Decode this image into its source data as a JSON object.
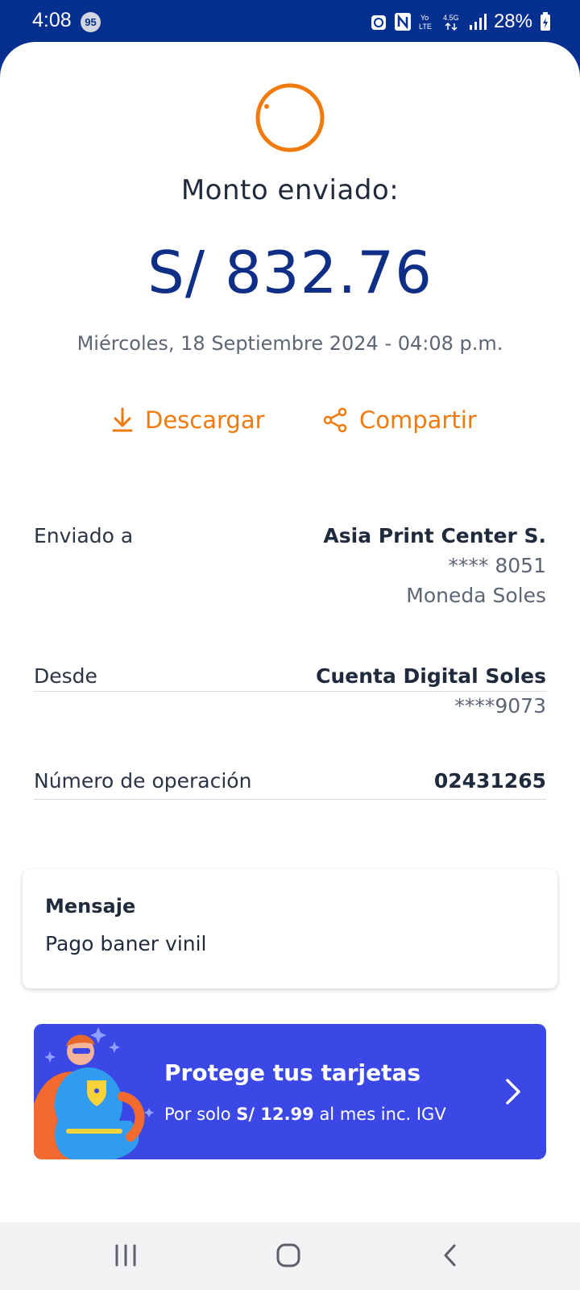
{
  "status_bar": {
    "time": "4:08",
    "notification_count": "95",
    "network_label": "4.5G",
    "volte_label": "Yo LTE",
    "battery": "28%"
  },
  "receipt": {
    "title": "Monto enviado:",
    "amount": "S/ 832.76",
    "datetime": "Miércoles, 18 Septiembre 2024 - 04:08 p.m.",
    "spinner_color": "#f07a0c",
    "amount_color": "#0f2e86"
  },
  "actions": {
    "download_label": "Descargar",
    "share_label": "Compartir",
    "accent_color": "#f07a0c"
  },
  "details": {
    "recipient_label": "Enviado a",
    "recipient_name": "Asia Print Center S.",
    "recipient_account": "**** 8051",
    "recipient_currency": "Moneda Soles",
    "from_label": "Desde",
    "from_account_name": "Cuenta Digital Soles",
    "from_account_number": "****9073",
    "operation_label": "Número de operación",
    "operation_number": "02431265"
  },
  "message": {
    "title": "Mensaje",
    "text": "Pago baner vinil"
  },
  "promo": {
    "title": "Protege tus tarjetas",
    "subtitle_prefix": "Por solo ",
    "subtitle_price": "S/ 12.99",
    "subtitle_suffix": " al mes inc. IGV",
    "background_color": "#3b48e6"
  },
  "nav": {
    "recent_icon": "recent-apps-icon",
    "home_icon": "home-icon",
    "back_icon": "back-icon"
  }
}
